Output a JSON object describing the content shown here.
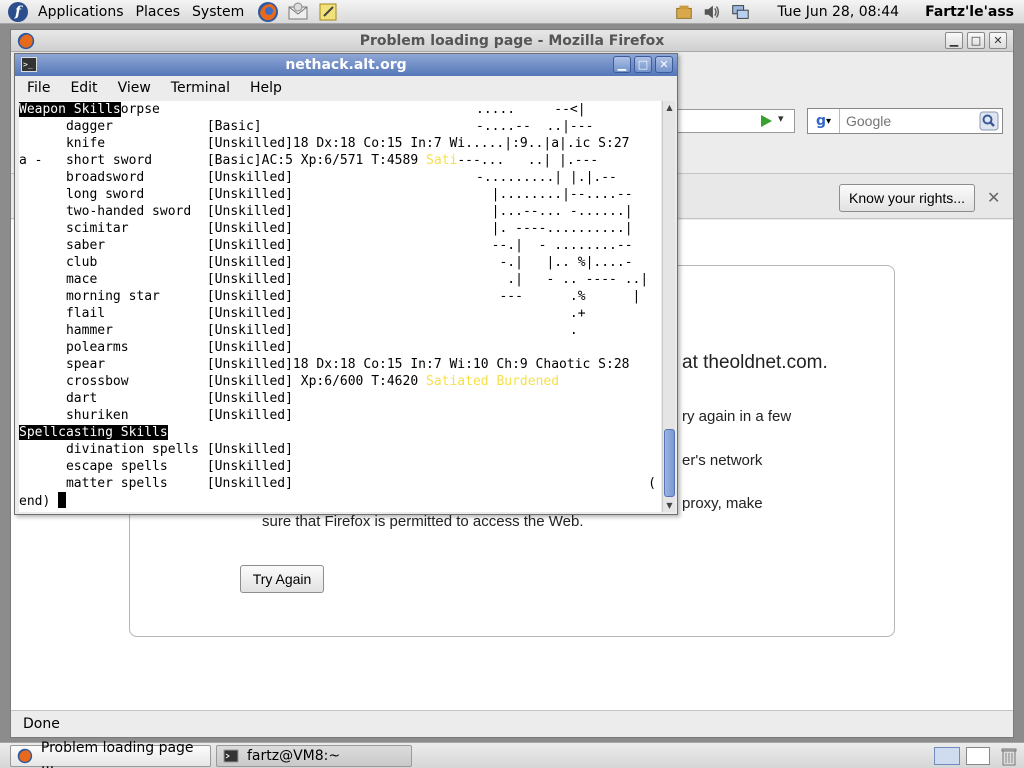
{
  "top_panel": {
    "menus": [
      "Applications",
      "Places",
      "System"
    ],
    "clock": "Tue Jun 28, 08:44",
    "user": "Fartz'le'ass"
  },
  "firefox": {
    "title": "Problem loading page - Mozilla Firefox",
    "search_placeholder": "Google",
    "notify_button": "Know your rights...",
    "error_lines": [
      "at theoldnet.com.",
      "ry again in a few",
      "er's network",
      "proxy, make",
      "sure that Firefox is permitted to access the Web."
    ],
    "try_again": "Try Again",
    "status": "Done"
  },
  "terminal": {
    "title": "nethack.alt.org",
    "menus": [
      "File",
      "Edit",
      "View",
      "Terminal",
      "Help"
    ],
    "lines": [
      {
        "left": "Weapon Skills",
        "leftInv": true,
        "rest": "orpse",
        "right": ".....     --<|"
      },
      {
        "left": "      dagger            [Basic]",
        "right": "-....--  ..|---"
      },
      {
        "left": "      knife             [Unskilled]18 Dx:18 Co:15 In:7 Wi.....|:9..|a|.ic S:27"
      },
      {
        "left": "a -   short sword       [Basic]AC:5 Xp:6/571 T:4589 ",
        "yellow": "Sati",
        "tail": "---...   ..| |.---"
      },
      {
        "left": "      broadsword        [Unskilled]",
        "right": "-.........| |.|.--"
      },
      {
        "left": "      long sword        [Unskilled]",
        "right": "  |........|--....--"
      },
      {
        "left": "      two-handed sword  [Unskilled]",
        "right": "  |...--... -......|"
      },
      {
        "left": "      scimitar          [Unskilled]",
        "right": "  |. ----..........|"
      },
      {
        "left": "      saber             [Unskilled]",
        "right": "  --.|  - ........--"
      },
      {
        "left": "      club              [Unskilled]",
        "right": "   -.|   |.. %|....-"
      },
      {
        "left": "      mace              [Unskilled]",
        "right": "    .|   - .. ---- ..|"
      },
      {
        "left": "      morning star      [Unskilled]",
        "right": "   ---      .%      |"
      },
      {
        "left": "      flail             [Unskilled]",
        "right": "            .+"
      },
      {
        "left": "      hammer            [Unskilled]",
        "right": "            ."
      },
      {
        "left": "      polearms          [Unskilled]"
      },
      {
        "left": "      spear             [Unskilled]18 Dx:18 Co:15 In:7 Wi:10 Ch:9 Chaotic S:28"
      },
      {
        "left": "      crossbow          [Unskilled] Xp:6/600 T:4620 ",
        "yellow": "Satiated Burdened"
      },
      {
        "left": "      dart              [Unskilled]"
      },
      {
        "left": "      shuriken          [Unskilled]"
      },
      {
        "left": "Spellcasting Skills",
        "leftInv": true
      },
      {
        "left": "      divination spells [Unskilled]"
      },
      {
        "left": "      escape spells     [Unskilled]"
      },
      {
        "left": "      matter spells     [Unskilled]",
        "right": "                      ("
      },
      {
        "left": "end) ",
        "cursor": true
      }
    ]
  },
  "taskbar": {
    "tasks": [
      "Problem loading page ...",
      "fartz@VM8:~"
    ]
  }
}
